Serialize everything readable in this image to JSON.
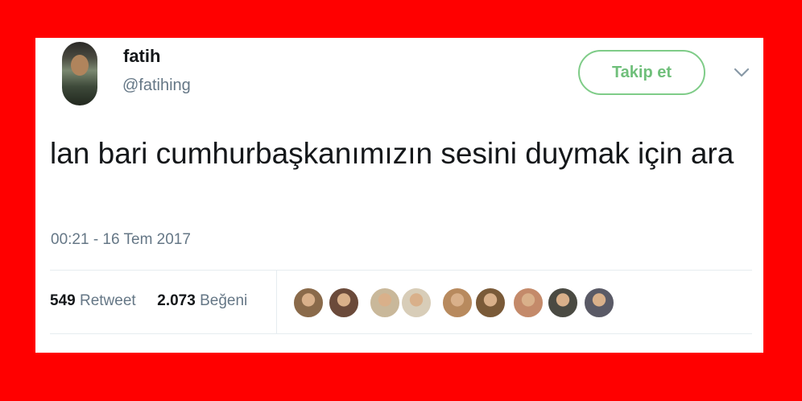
{
  "tweet": {
    "user": {
      "display_name": "fatih",
      "handle": "@fatihing",
      "avatar_icon": "profile-photo"
    },
    "follow_label": "Takip et",
    "text": "lan bari cumhurbaşkanımızın sesini duymak için ara",
    "timestamp": "00:21 - 16 Tem 2017",
    "stats": {
      "retweet_count": "549",
      "retweet_label": "Retweet",
      "like_count": "2.073",
      "like_label": "Beğeni"
    },
    "likers": [
      {
        "name": "liker-1",
        "color": "#8a6a4a"
      },
      {
        "name": "liker-2",
        "color": "#6b4a3a"
      },
      {
        "name": "liker-3",
        "color": "#c9b89a"
      },
      {
        "name": "liker-4",
        "color": "#d8cdb8"
      },
      {
        "name": "liker-5",
        "color": "#b88a5e"
      },
      {
        "name": "liker-6",
        "color": "#7a5a38"
      },
      {
        "name": "liker-7",
        "color": "#c48a6a"
      },
      {
        "name": "liker-8",
        "color": "#4a4a42"
      },
      {
        "name": "liker-9",
        "color": "#5a5a66"
      }
    ]
  },
  "colors": {
    "background": "#ff0000",
    "card": "#ffffff",
    "follow_accent": "#7fcc88",
    "secondary_text": "#657786"
  }
}
